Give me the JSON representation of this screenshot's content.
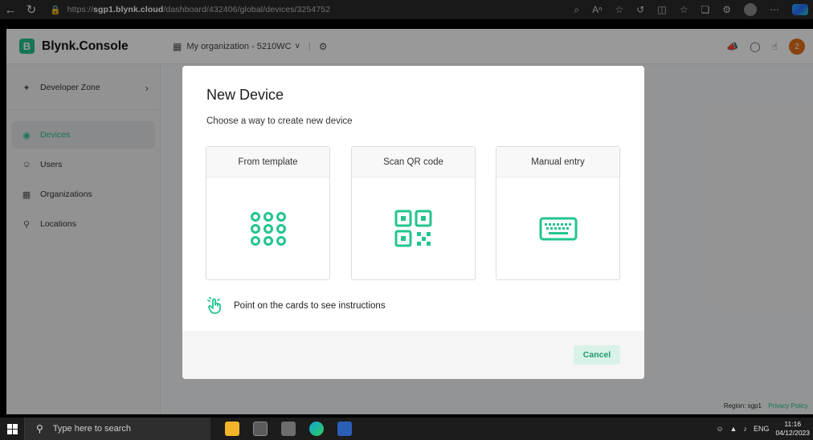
{
  "browser": {
    "url_prefix": "https://",
    "url_host": "sgp1.blynk.cloud",
    "url_path": "/dashboard/432406/global/devices/3254752"
  },
  "app": {
    "brand_letter": "B",
    "brand_name": "Blynk.Console",
    "organization": "My organization - 5210WC",
    "avatar_letter": "2"
  },
  "sidebar": {
    "developer_zone": "Developer Zone",
    "items": [
      {
        "label": "Devices",
        "icon": "cube-icon",
        "active": true
      },
      {
        "label": "Users",
        "icon": "users-icon"
      },
      {
        "label": "Organizations",
        "icon": "building-icon"
      },
      {
        "label": "Locations",
        "icon": "pin-icon"
      }
    ]
  },
  "footer": {
    "region": "Region: sgp1",
    "privacy": "Privacy Policy"
  },
  "modal": {
    "title": "New Device",
    "subtitle": "Choose a way to create new device",
    "cards": [
      {
        "label": "From template",
        "icon": "grid-dots-icon"
      },
      {
        "label": "Scan QR code",
        "icon": "qr-code-icon"
      },
      {
        "label": "Manual entry",
        "icon": "keyboard-icon"
      }
    ],
    "hint": "Point on the cards to see instructions",
    "cancel_label": "Cancel"
  },
  "taskbar": {
    "search_placeholder": "Type here to search",
    "language": "ENG",
    "time": "11:16",
    "date": "04/12/2023"
  },
  "colors": {
    "accent": "#23c48e",
    "overlay": "rgba(0,0,0,0.40)"
  }
}
